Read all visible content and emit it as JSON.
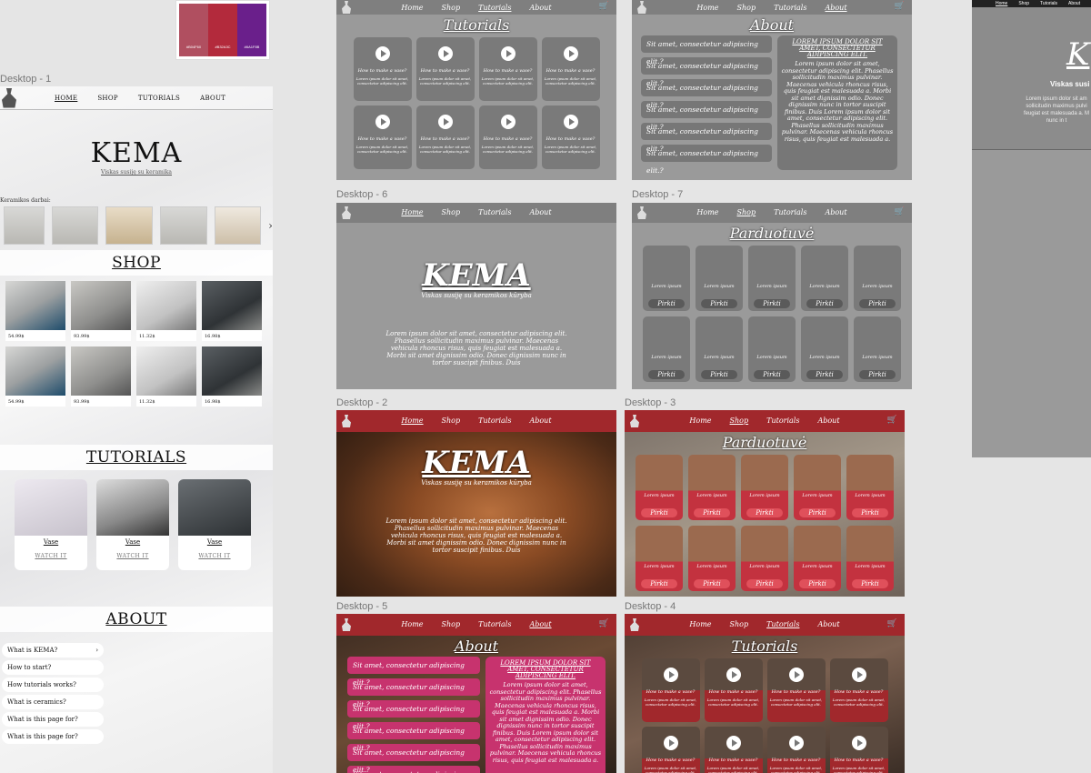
{
  "swatch": {
    "labels": [
      "#B04F60",
      "#B32A3C",
      "#6A1F8B"
    ],
    "colors": [
      "#b04f60",
      "#b32a3c",
      "#6a1f8b"
    ]
  },
  "labels": {
    "d1": "Desktop - 1",
    "d6": "Desktop - 6",
    "d7": "Desktop - 7",
    "d2": "Desktop - 2",
    "d3": "Desktop - 3",
    "d5": "Desktop - 5",
    "d4": "Desktop - 4"
  },
  "main": {
    "nav": [
      "HOME",
      "SHOP",
      "TUTORIALS",
      "ABOUT"
    ],
    "title": "KEMA",
    "subtitle": "Viskas susiję su keramika",
    "strip_label": "Keramikos darbai:",
    "shop_title": "SHOP",
    "prices": [
      "54.99$",
      "93.99$",
      "11.32$",
      "16.98$",
      "54.99$",
      "93.99$",
      "11.32$",
      "16.98$"
    ],
    "tutorials_title": "TUTORIALS",
    "tut_cards": [
      {
        "t": "Vase",
        "w": "WATCH IT"
      },
      {
        "t": "Vase",
        "w": "WATCH IT"
      },
      {
        "t": "Vase",
        "w": "WATCH IT"
      }
    ],
    "about_title": "ABOUT",
    "faq": [
      "What is KEMA?",
      "How to start?",
      "How tutorials works?",
      "What is ceramics?",
      "What is this page for?",
      "What is this page for?"
    ]
  },
  "nav": {
    "home": "Home",
    "shop": "Shop",
    "tutorials": "Tutorials",
    "about": "About",
    "cart": "🛒"
  },
  "tutorials": {
    "title": "Tutorials",
    "card_title": "How to make a vase?",
    "card_sub": "Lorem ipsum dolor sit amet, consectetur adipiscing elit."
  },
  "about": {
    "title": "About",
    "question": "Sit amet, consectetur adipiscing elit.?",
    "heading": "LOREM IPSUM DOLOR SIT AMET, CONSECTETUR ADIPISCING ELIT.",
    "body": "Lorem ipsum dolor sit amet, consectetur adipiscing elit. Phasellus sollicitudin maximus pulvinar. Maecenas vehicula rhoncus risus, quis feugiat est malesuada a. Morbi sit amet dignissim odio. Donec dignissim nunc in tortor suscipit finibus. Duis Lorem ipsum dolor sit amet, consectetur adipiscing elit. Phasellus sollicitudin maximus pulvinar. Maecenas vehicula rhoncus risus, quis feugiat est malesuada a."
  },
  "hero": {
    "title": "KEMA",
    "subtitle": "Viskas susiję su keramikos kūryba",
    "body": "Lorem ipsum dolor sit amet, consectetur adipiscing elit. Phasellus sollicitudin maximus pulvinar. Maecenas vehicula rhoncus risus, quis feugiat est malesuada a. Morbi sit amet dignissim odio. Donec dignissim nunc in tortor suscipit finibus. Duis"
  },
  "shop": {
    "title": "Parduotuvė",
    "item": "Lorem ipsum",
    "buy": "Pirkti"
  },
  "right": {
    "nav": [
      "Home",
      "Shop",
      "Tutorials",
      "About"
    ],
    "title": "K",
    "subtitle": "Viskas susi",
    "body": "Lorem ipsum dolor sit am sollicitudin maximus pulvi feugiat est malesuada a. M nunc in t"
  }
}
